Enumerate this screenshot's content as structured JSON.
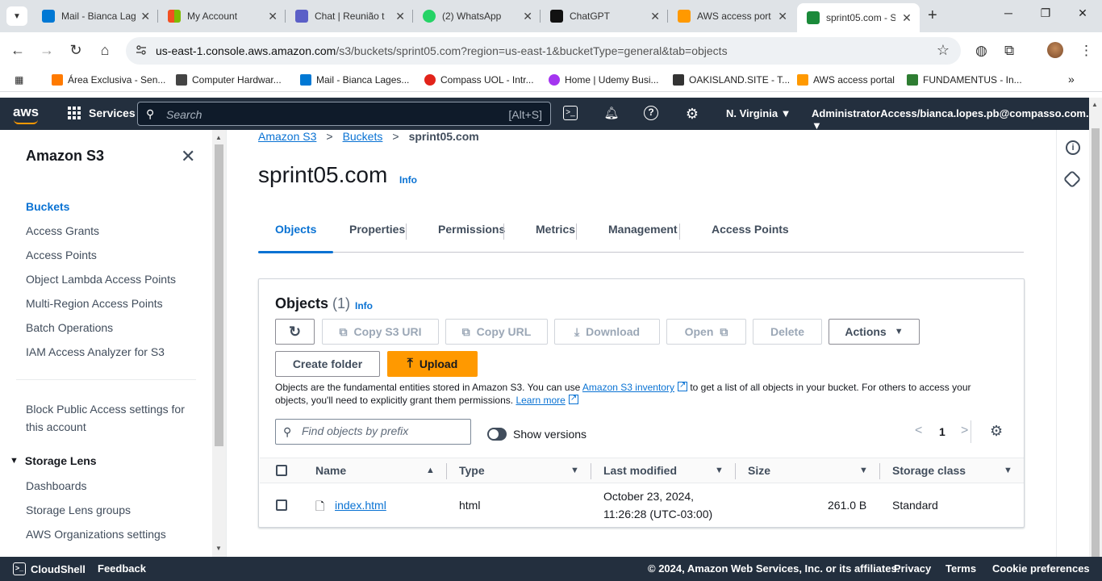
{
  "browser": {
    "tabs": [
      {
        "label": "Mail - Bianca Lag",
        "color": "#0078d4"
      },
      {
        "label": "My Account",
        "color": "#f25022"
      },
      {
        "label": "Chat | Reunião t",
        "color": "#5b5fc7"
      },
      {
        "label": "(2) WhatsApp",
        "color": "#25d366"
      },
      {
        "label": "ChatGPT",
        "color": "#111111"
      },
      {
        "label": "AWS access port",
        "color": "#ff9900"
      },
      {
        "label": "sprint05.com - S",
        "color": "#1b8a3a"
      }
    ],
    "url_host": "us-east-1.console.aws.amazon.com",
    "url_path": "/s3/buckets/sprint05.com?region=us-east-1&bucketType=general&tab=objects",
    "bookmarks": [
      {
        "label": "Área Exclusiva - Sen...",
        "color": "#ff7a00"
      },
      {
        "label": "Computer Hardwar...",
        "color": "#444444"
      },
      {
        "label": "Mail - Bianca Lages...",
        "color": "#0078d4"
      },
      {
        "label": "Compass UOL - Intr...",
        "color": "#e2231a"
      },
      {
        "label": "Home | Udemy Busi...",
        "color": "#a435f0"
      },
      {
        "label": "OAKISLAND.SITE - T...",
        "color": "#333333"
      },
      {
        "label": "AWS access portal",
        "color": "#ff9900"
      },
      {
        "label": "FUNDAMENTUS - In...",
        "color": "#2e7d32"
      }
    ]
  },
  "aws_header": {
    "logo": "aws",
    "services": "Services",
    "search_placeholder": "Search",
    "search_shortcut": "[Alt+S]",
    "region": "N. Virginia",
    "account": "AdministratorAccess/bianca.lopes.pb@compasso.com.br"
  },
  "sidebar": {
    "title": "Amazon S3",
    "items": [
      {
        "label": "Buckets",
        "active": true
      },
      {
        "label": "Access Grants"
      },
      {
        "label": "Access Points"
      },
      {
        "label": "Object Lambda Access Points"
      },
      {
        "label": "Multi-Region Access Points"
      },
      {
        "label": "Batch Operations"
      },
      {
        "label": "IAM Access Analyzer for S3"
      }
    ],
    "block_public_line1": "Block Public Access settings for",
    "block_public_line2": "this account",
    "section": "Storage Lens",
    "section_items": [
      "Dashboards",
      "Storage Lens groups",
      "AWS Organizations settings"
    ]
  },
  "breadcrumb": [
    "Amazon S3",
    "Buckets",
    "sprint05.com"
  ],
  "page": {
    "title": "sprint05.com",
    "info": "Info"
  },
  "tabs": [
    "Objects",
    "Properties",
    "Permissions",
    "Metrics",
    "Management",
    "Access Points"
  ],
  "objects_panel": {
    "title": "Objects",
    "count": "(1)",
    "info": "Info",
    "buttons": {
      "copy_s3_uri": "Copy S3 URI",
      "copy_url": "Copy URL",
      "download": "Download",
      "open": "Open",
      "delete": "Delete",
      "actions": "Actions",
      "create_folder": "Create folder",
      "upload": "Upload"
    },
    "desc_1": "Objects are the fundamental entities stored in Amazon S3. You can use ",
    "desc_link_1": "Amazon S3 inventory",
    "desc_2": " to get a list of all objects in your bucket. For others to access your objects, you'll need to explicitly grant them permissions. ",
    "desc_link_2": "Learn more",
    "find_placeholder": "Find objects by prefix",
    "show_versions": "Show versions",
    "page_number": "1",
    "columns": [
      "Name",
      "Type",
      "Last modified",
      "Size",
      "Storage class"
    ],
    "rows": [
      {
        "name": "index.html",
        "type": "html",
        "modified_line1": "October 23, 2024,",
        "modified_line2": "11:26:28 (UTC-03:00)",
        "size": "261.0 B",
        "storage_class": "Standard"
      }
    ]
  },
  "footer": {
    "cloudshell": "CloudShell",
    "feedback": "Feedback",
    "copyright": "© 2024, Amazon Web Services, Inc. or its affiliates.",
    "privacy": "Privacy",
    "terms": "Terms",
    "cookies": "Cookie preferences"
  }
}
